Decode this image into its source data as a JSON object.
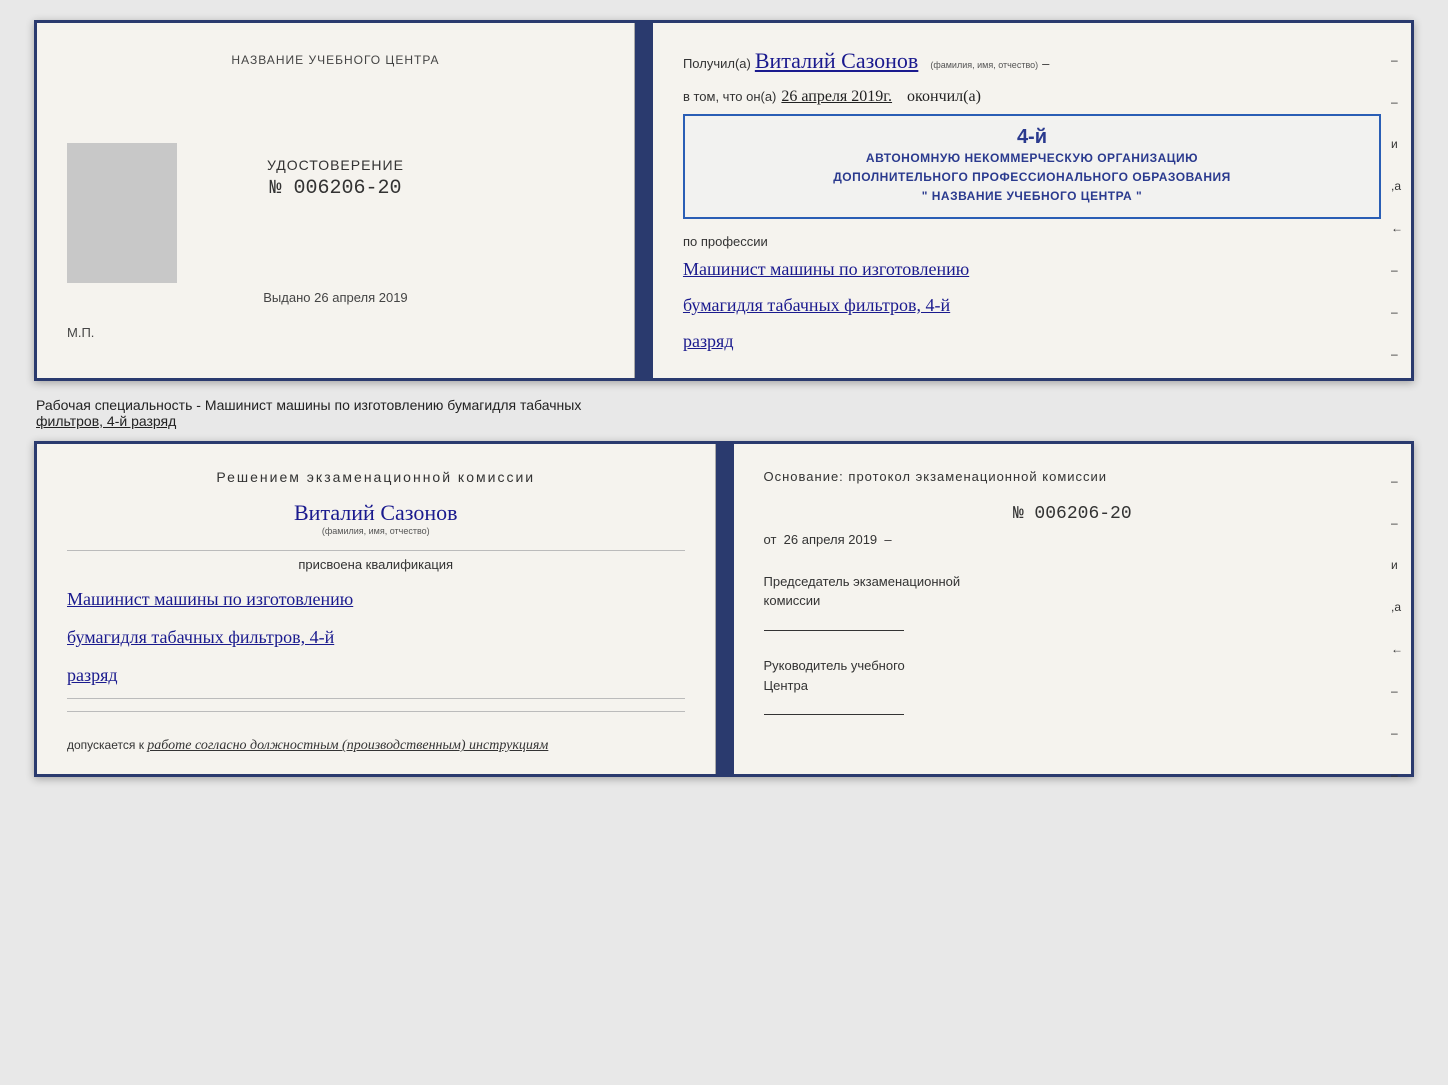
{
  "top_cert": {
    "left_title": "НАЗВАНИЕ УЧЕБНОГО ЦЕНТРА",
    "udostoverenie_label": "УДОСТОВЕРЕНИЕ",
    "udostoverenie_number": "№ 006206-20",
    "vydano_label": "Выдано",
    "vydano_date": "26 апреля 2019",
    "mp_label": "М.П.",
    "poluchil_label": "Получил(а)",
    "recipient_name": "Виталий Сазонов",
    "fio_subtitle": "(фамилия, имя, отчество)",
    "dash": "–",
    "vtom_label": "в том, что он(а)",
    "vtom_date": "26 апреля 2019г.",
    "okonchil_label": "окончил(а)",
    "stamp_line1": "АВТОНОМНУЮ НЕКОММЕРЧЕСКУЮ ОРГАНИЗАЦИЮ",
    "stamp_line2": "ДОПОЛНИТЕЛЬНОГО ПРОФЕССИОНАЛЬНОГО ОБРАЗОВАНИЯ",
    "stamp_name": "\" НАЗВАНИЕ УЧЕБНОГО ЦЕНТРА \"",
    "stamp_big": "4-й",
    "po_professii": "по профессии",
    "profession_line1": "Машинист машины по изготовлению",
    "profession_line2": "бумагидля табачных фильтров, 4-й",
    "profession_line3": "разряд",
    "sidebar_marks": [
      "–",
      "–",
      "и",
      ",а",
      "←",
      "–",
      "–",
      "–"
    ]
  },
  "between_text": {
    "line1": "Рабочая специальность - Машинист машины по изготовлению бумагидля табачных",
    "line2_underlined": "фильтров, 4-й разряд"
  },
  "bottom_cert": {
    "left": {
      "resheniem_label": "Решением  экзаменационной  комиссии",
      "name": "Виталий Сазонов",
      "fio_subtitle": "(фамилия, имя, отчество)",
      "prisvoyena_label": "присвоена квалификация",
      "profession_line1": "Машинист машины по изготовлению",
      "profession_line2": "бумагидля табачных фильтров, 4-й",
      "profession_line3": "разряд",
      "dopuskaetsya_label": "допускается к",
      "dopuskaetsya_value": "работе согласно должностным (производственным) инструкциям"
    },
    "right": {
      "osnovanie_label": "Основание: протокол экзаменационной  комиссии",
      "protocol_number": "№  006206-20",
      "ot_label": "от",
      "ot_date": "26 апреля 2019",
      "predsedatel_label": "Председатель экзаменационной",
      "predsedatel_label2": "комиссии",
      "rukovoditel_label": "Руководитель учебного",
      "rukovoditel_label2": "Центра"
    },
    "sidebar_marks": [
      "–",
      "–",
      "и",
      ",а",
      "←",
      "–",
      "–",
      "–"
    ]
  }
}
